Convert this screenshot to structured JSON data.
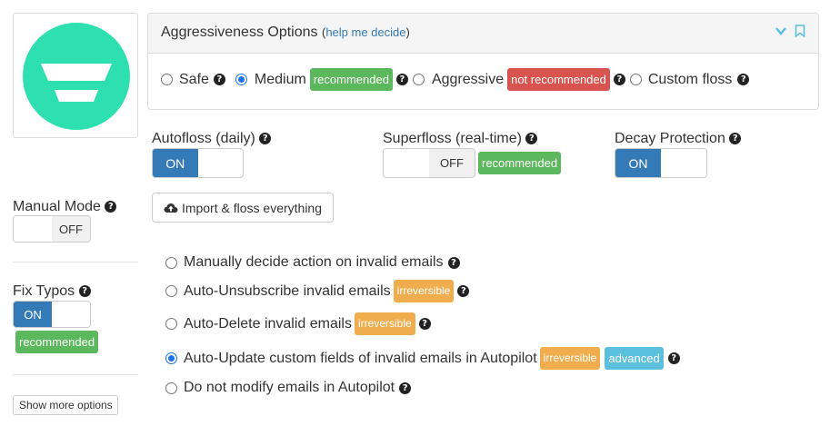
{
  "logo": {
    "name": "logo",
    "color": "#2ee0b0"
  },
  "aggressiveness": {
    "title": "Aggressiveness Options",
    "help_link": "help me decide",
    "options": [
      {
        "label": "Safe",
        "selected": false
      },
      {
        "label": "Medium",
        "selected": true,
        "badge": "recommended"
      },
      {
        "label": "Aggressive",
        "selected": false,
        "badge": "not recommended"
      },
      {
        "label": "Custom floss",
        "selected": false
      }
    ]
  },
  "autofloss": {
    "label": "Autofloss (daily)",
    "state": "ON"
  },
  "superfloss": {
    "label": "Superfloss (real-time)",
    "state": "OFF",
    "badge": "recommended"
  },
  "decay": {
    "label": "Decay Protection",
    "state": "ON"
  },
  "manual_mode": {
    "label": "Manual Mode",
    "state": "OFF"
  },
  "import_button": {
    "label": "Import & floss everything"
  },
  "fix_typos": {
    "label": "Fix Typos",
    "state": "ON",
    "badge": "recommended"
  },
  "show_more": {
    "label": "Show more options"
  },
  "invalid_actions": [
    {
      "label": "Manually decide action on invalid emails",
      "selected": false
    },
    {
      "label": "Auto-Unsubscribe invalid emails",
      "selected": false,
      "badges": [
        "irreversible"
      ]
    },
    {
      "label": "Auto-Delete invalid emails",
      "selected": false,
      "badges": [
        "irreversible"
      ]
    },
    {
      "label": "Auto-Update custom fields of invalid emails in Autopilot",
      "selected": true,
      "badges": [
        "irreversible",
        "advanced"
      ]
    },
    {
      "label": "Do not modify emails in Autopilot",
      "selected": false
    }
  ],
  "colors": {
    "green": "#5cb85c",
    "red": "#d9534f",
    "orange": "#f0ad4e",
    "cyan": "#5bc0de",
    "blue": "#337ab7",
    "teal": "#2ee0b0"
  },
  "icons": [
    "chevron-down-icon",
    "bookmark-icon",
    "question-circle-icon",
    "cloud-upload-icon"
  ]
}
